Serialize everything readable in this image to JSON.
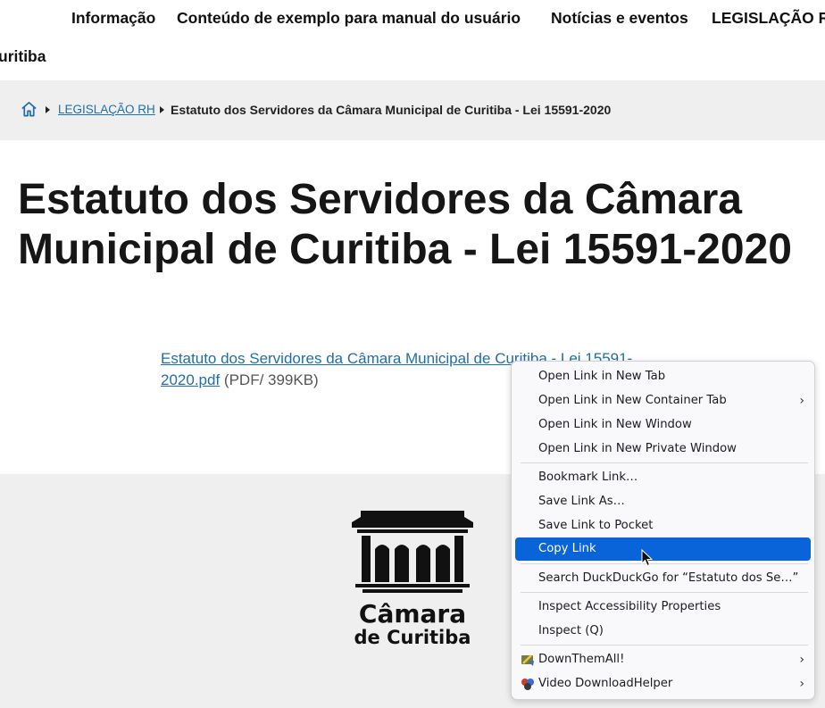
{
  "nav": {
    "items": [
      "Informação",
      "Conteúdo de exemplo para manual do usuário",
      "Notícias e eventos",
      "LEGISLAÇÃO RH"
    ],
    "second_row": "uritiba"
  },
  "breadcrumb": {
    "home_icon": "home-icon",
    "section": "LEGISLAÇÃO RH",
    "current": "Estatuto dos Servidores da Câmara Municipal de Curitiba - Lei 15591-2020"
  },
  "page": {
    "title": "Estatuto dos Servidores da Câmara Municipal de Curitiba - Lei 15591-2020",
    "file_link": "Estatuto dos Servidores da Câmara Municipal de Curitiba - Lei 15591-2020.pdf",
    "file_meta": " (PDF/ 399KB)"
  },
  "footer": {
    "logo_line1": "Câmara",
    "logo_line2": "de Curitiba"
  },
  "context_menu": {
    "items": [
      {
        "label": "Open Link in New Tab",
        "submenu": false
      },
      {
        "label": "Open Link in New Container Tab",
        "submenu": true
      },
      {
        "label": "Open Link in New Window",
        "submenu": false
      },
      {
        "label": "Open Link in New Private Window",
        "submenu": false
      },
      {
        "label": "Bookmark Link…",
        "submenu": false
      },
      {
        "label": "Save Link As…",
        "submenu": false
      },
      {
        "label": "Save Link to Pocket",
        "submenu": false
      },
      {
        "label": "Copy Link",
        "submenu": false,
        "highlighted": true
      },
      {
        "label": "Search DuckDuckGo for “Estatuto dos Se…”",
        "submenu": false
      },
      {
        "label": "Inspect Accessibility Properties",
        "submenu": false
      },
      {
        "label": "Inspect (Q)",
        "submenu": false
      },
      {
        "label": "DownThemAll!",
        "submenu": true,
        "icon": "downthemall-icon"
      },
      {
        "label": "Video DownloadHelper",
        "submenu": true,
        "icon": "video-downloadhelper-icon"
      }
    ],
    "highlight_color": "#0a64d9"
  },
  "colors": {
    "link": "#1f6fa8",
    "breadcrumb_bg": "#efefef",
    "footer_bg": "#efefef"
  }
}
